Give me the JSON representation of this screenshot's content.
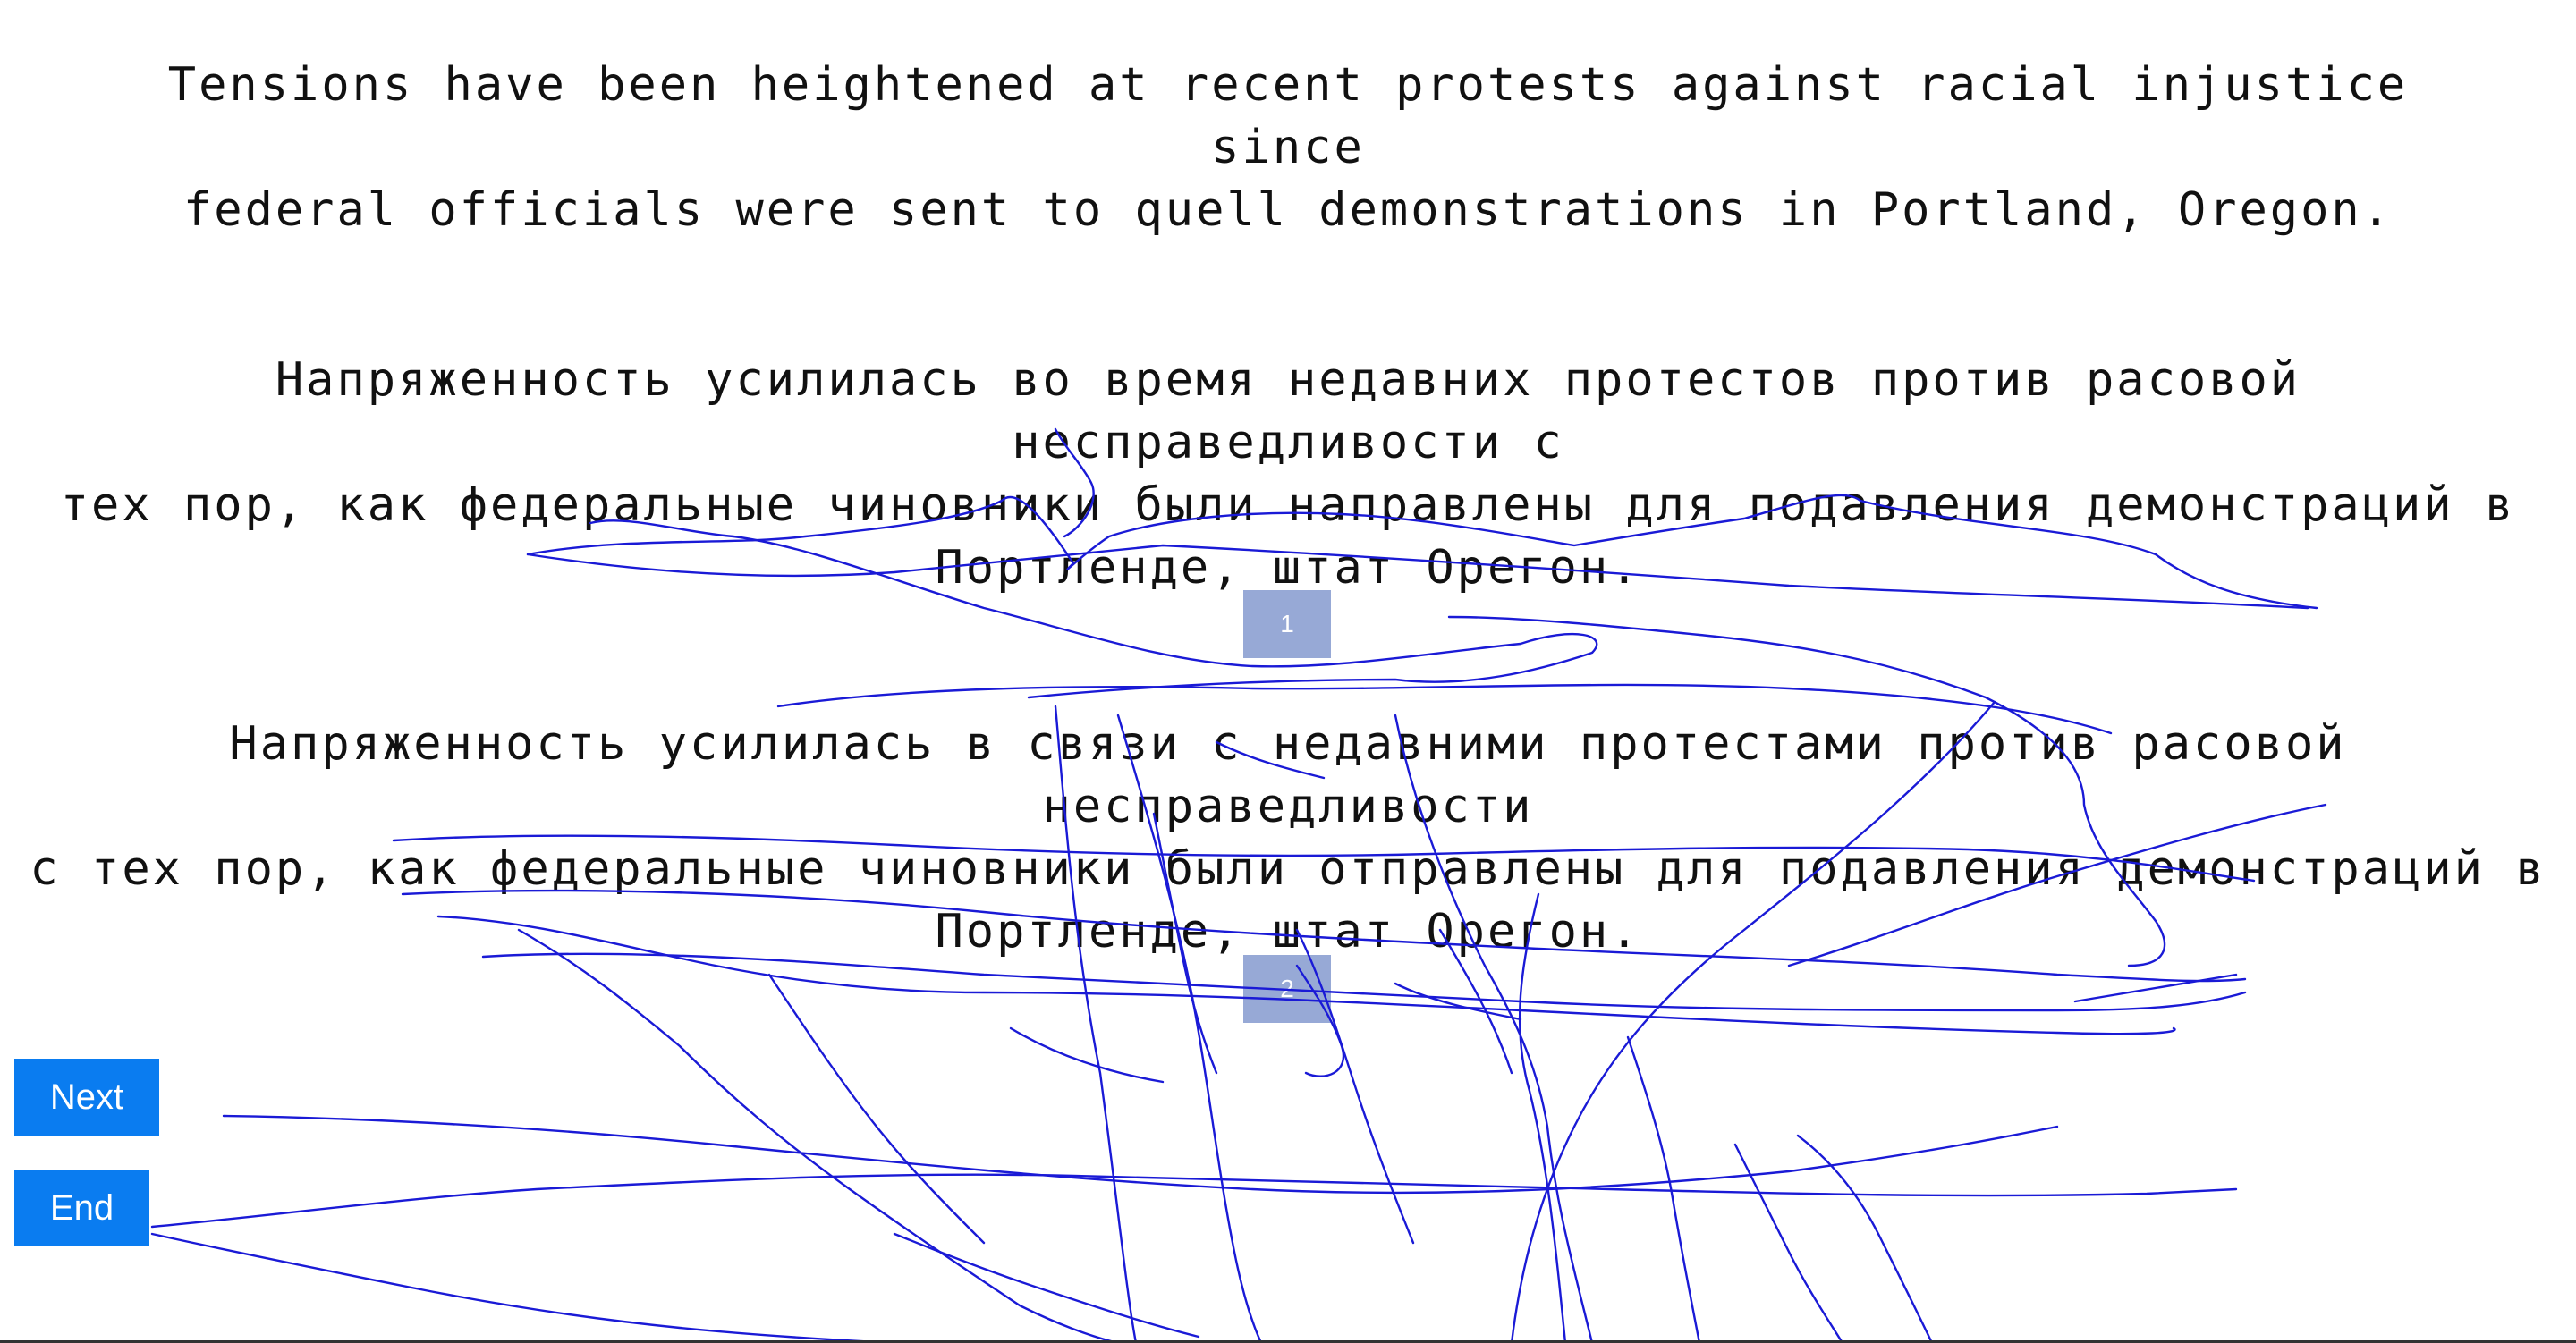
{
  "source": {
    "text": "Tensions have been heightened at recent protests against racial injustice since\nfederal officials were sent to quell demonstrations in Portland, Oregon."
  },
  "translations": [
    {
      "text": "Напряженность усилилась во время недавних протестов против расовой несправедливости с\nтех пор, как федеральные чиновники были направлены для подавления демонстраций в\nПортленде, штат Орегон.",
      "rank": "1"
    },
    {
      "text": "Напряженность усилилась в связи с недавними протестами против расовой несправедливости\nс тех пор, как федеральные чиновники были отправлены для подавления демонстраций в\nПортленде, штат Орегон.",
      "rank": "2"
    }
  ],
  "buttons": {
    "next_label": "Next",
    "end_label": "End"
  },
  "colors": {
    "button_bg": "#0a7cf0",
    "rank_box_bg": "#97a9d6",
    "scribble_stroke": "#1a1ad6"
  }
}
